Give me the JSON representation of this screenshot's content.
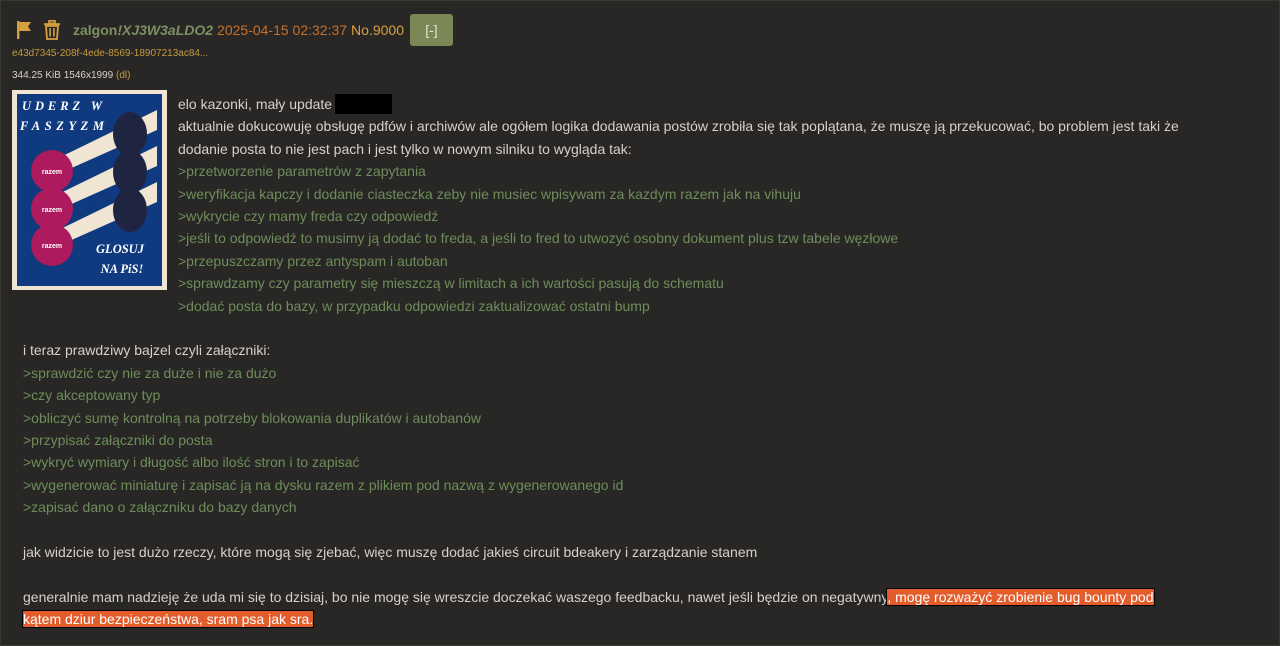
{
  "post": {
    "name": "zalgon",
    "tripcode": "!XJ3W3aLDO2",
    "date": "2025-04-15 02:32:37",
    "number": "No.9000",
    "hide_label": "[-]",
    "file": {
      "name": "e43d7345-208f-4ede-8569-18907213ac84...",
      "info": "344.25 KiB 1546x1999",
      "dl_label": "(dl)"
    },
    "thumbnail_text": {
      "top": "UDERZ W FASZYZM",
      "bottom": "GLOSUJ NA PiS!",
      "circle": "razem"
    },
    "lines_first": [
      "elo kazonki, mały update",
      "aktualnie dokucowuję obsługę pdfów i archiwów ale ogółem logika dodawania postów zrobiła się tak poplątana, że muszę ją przekucować, bo problem jest taki że",
      "dodanie posta to nie jest pach i jest tylko w nowym silniku to wygląda tak:",
      ">przetworzenie parametrów z zapytania",
      ">weryfikacja kapczy i dodanie ciasteczka zeby nie musiec wpisywam za kazdym razem jak na vihuju",
      ">wykrycie czy mamy freda czy odpowiedź",
      ">jeśli to odpowiedź to musimy ją dodać to freda, a jeśli to fred to utwozyć osobny dokument plus tzw tabele węzłowe",
      ">przepuszczamy przez antyspam i autoban",
      ">sprawdzamy czy parametry się mieszczą w limitach a ich wartości pasują do schematu",
      ">dodać posta do bazy, w przypadku odpowiedzi zaktualizować ostatni bump"
    ],
    "lines_attach": [
      "i teraz prawdziwy bajzel czyli załączniki:",
      ">sprawdzić czy nie za duże i nie za dużo",
      ">czy akceptowany typ",
      ">obliczyć sumę kontrolną na potrzeby blokowania duplikatów i autobanów",
      ">przypisać załączniki do posta",
      ">wykryć wymiary i długość albo ilość stron i to zapisać",
      ">wygenerować miniaturę i zapisać ją na dysku razem z plikiem pod nazwą z wygenerowanego id",
      ">zapisać dano o załączniku do bazy danych"
    ],
    "line_circuit": "jak widzicie to jest dużo rzeczy, które mogą się zjebać, więc muszę dodać jakieś circuit bdeakery i zarządzanie stanem",
    "line_final_plain": "generalnie mam nadzieję że uda mi się to dzisiaj, bo nie mogę się wreszcie doczekać waszego feedbacku, nawet jeśli będzie on negatywny",
    "line_final_hl1": ", mogę rozważyć zrobienie bug bounty pod",
    "line_final_hl2": "kątem dziur bezpieczeństwa, sram psa jak sra."
  },
  "colors": {
    "greentext": "#6e8d5a",
    "name": "#7d8f63",
    "date": "#c4712f",
    "postno": "#d8a040",
    "highlight": "#e35d2c"
  },
  "icons": [
    "flag-icon",
    "trash-icon"
  ]
}
